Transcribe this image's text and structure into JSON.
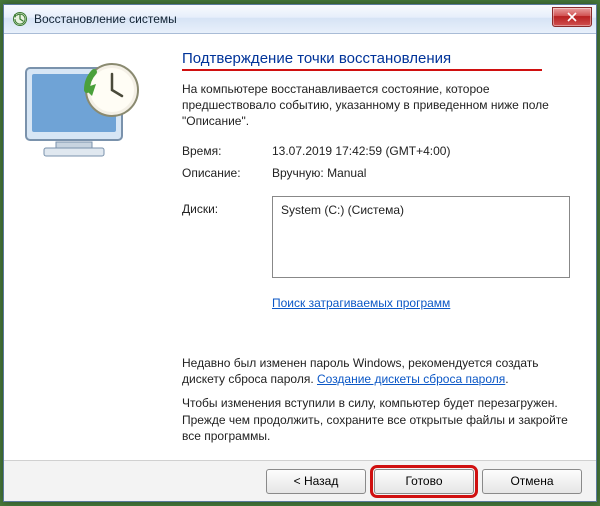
{
  "window": {
    "title": "Восстановление системы"
  },
  "heading": "Подтверждение точки восстановления",
  "intro": "На компьютере восстанавливается состояние, которое предшествовало событию, указанному в приведенном ниже поле \"Описание\".",
  "fields": {
    "time_label": "Время:",
    "time_value": "13.07.2019 17:42:59 (GMT+4:00)",
    "desc_label": "Описание:",
    "desc_value": "Вручную: Manual",
    "disks_label": "Диски:",
    "disk_value": "System (C:) (Система)"
  },
  "links": {
    "scan": "Поиск затрагиваемых программ",
    "password_disk": "Создание дискеты сброса пароля"
  },
  "notes": {
    "p1_a": "Недавно был изменен пароль Windows, рекомендуется создать дискету сброса пароля. ",
    "p2": "Чтобы изменения вступили в силу, компьютер будет перезагружен. Прежде чем продолжить, сохраните все открытые файлы и закройте все программы."
  },
  "buttons": {
    "back": "< Назад",
    "finish": "Готово",
    "cancel": "Отмена"
  }
}
